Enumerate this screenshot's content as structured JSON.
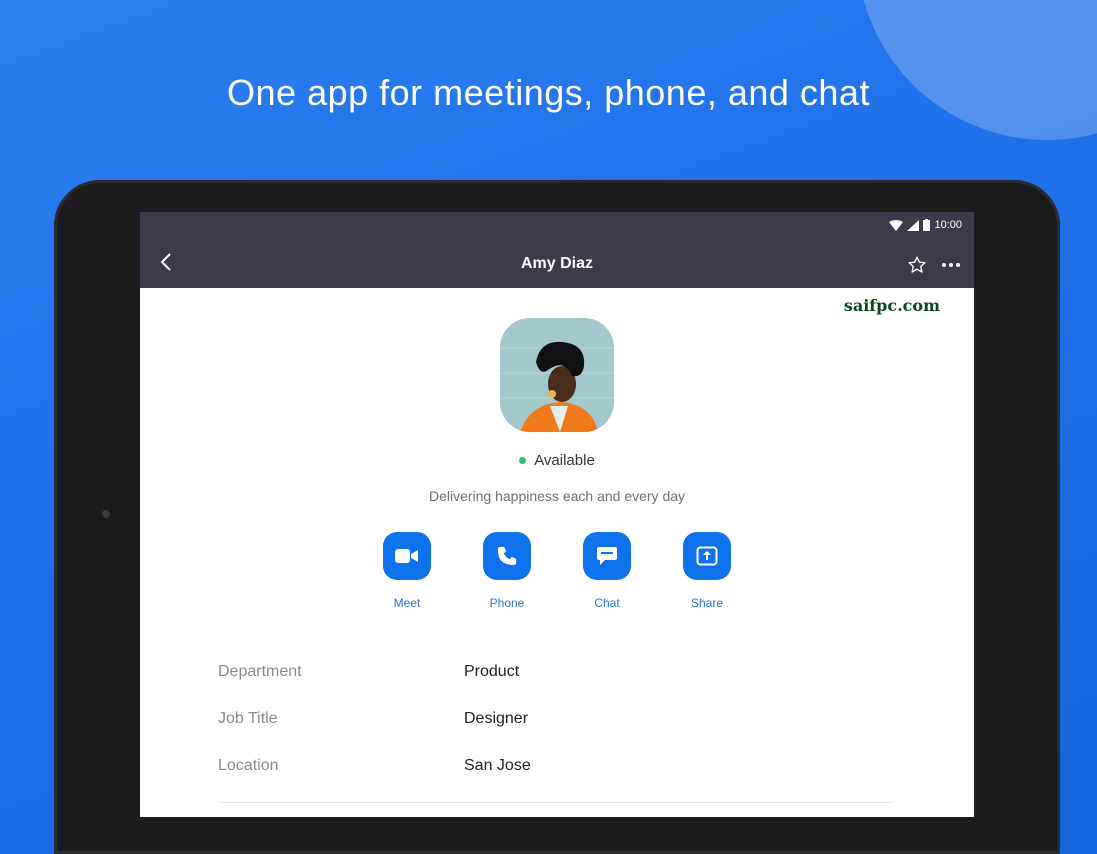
{
  "headline": "One app for meetings, phone, and chat",
  "status_bar": {
    "time": "10:00",
    "icons": [
      "wifi-icon",
      "signal-icon",
      "battery-icon"
    ]
  },
  "nav": {
    "title": "Amy Diaz",
    "back_icon": "chevron-left-icon",
    "favorite_icon": "star-outline-icon",
    "more_icon": "more-horizontal-icon"
  },
  "watermark": "saifpc.com",
  "profile": {
    "presence": "Available",
    "presence_color": "#2cc36b",
    "status_message": "Delivering happiness each and every day"
  },
  "actions": [
    {
      "label": "Meet",
      "icon": "video-camera-icon"
    },
    {
      "label": "Phone",
      "icon": "phone-icon"
    },
    {
      "label": "Chat",
      "icon": "chat-bubble-icon"
    },
    {
      "label": "Share",
      "icon": "share-upload-icon"
    }
  ],
  "details": [
    {
      "label": "Department",
      "value": "Product"
    },
    {
      "label": "Job Title",
      "value": "Designer"
    },
    {
      "label": "Location",
      "value": "San Jose"
    }
  ],
  "colors": {
    "background": "#1f6fe8",
    "navbar": "#3b3b4a",
    "accent": "#0e72ed",
    "action_label": "#2a6fd6"
  }
}
